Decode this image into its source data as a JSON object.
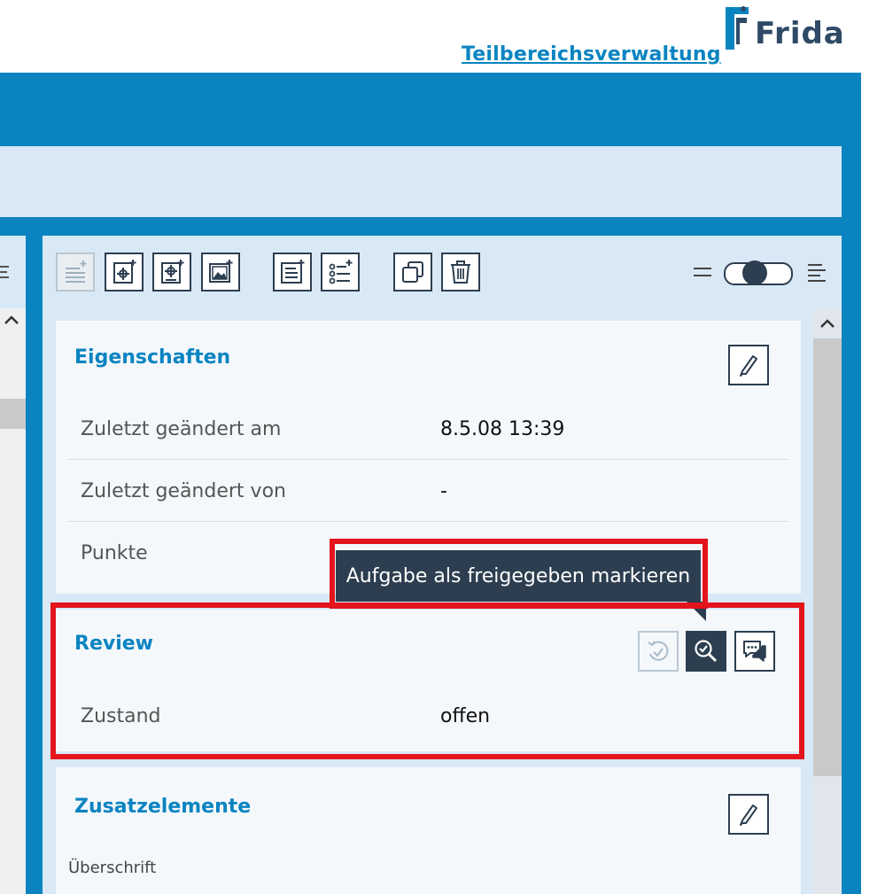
{
  "header": {
    "link_label": "Teilbereichsverwaltung",
    "logo_text": "Frida"
  },
  "toolbar": {
    "buttons": [
      {
        "name": "add-text-button",
        "icon": "text-add-icon",
        "disabled": true
      },
      {
        "name": "add-config-button",
        "icon": "gear-doc-add-icon",
        "disabled": false
      },
      {
        "name": "add-config2-button",
        "icon": "gear-doc-add-icon",
        "disabled": false
      },
      {
        "name": "add-image-button",
        "icon": "image-add-icon",
        "disabled": false
      },
      {
        "name": "add-paragraph-button",
        "icon": "paragraph-add-icon",
        "disabled": false
      },
      {
        "name": "add-list-button",
        "icon": "list-add-icon",
        "disabled": false
      },
      {
        "name": "copy-button",
        "icon": "copy-icon",
        "disabled": false
      },
      {
        "name": "delete-button",
        "icon": "trash-icon",
        "disabled": false
      }
    ],
    "toggle_state": "middle"
  },
  "properties": {
    "title": "Eigenschaften",
    "rows": [
      {
        "label": "Zuletzt geändert am",
        "value": "8.5.08 13:39"
      },
      {
        "label": "Zuletzt geändert von",
        "value": "-"
      },
      {
        "label": "Punkte",
        "value": ""
      }
    ]
  },
  "review": {
    "title": "Review",
    "state_label": "Zustand",
    "state_value": "offen",
    "tooltip": "Aufgabe als freigegeben markieren"
  },
  "extras": {
    "title": "Zusatzelemente",
    "first_label": "Überschrift"
  },
  "colors": {
    "brand_blue": "#0a84c1",
    "dark_navy": "#2c3e50",
    "highlight_red": "#e3141c",
    "panel_light": "#d9e8f5"
  }
}
